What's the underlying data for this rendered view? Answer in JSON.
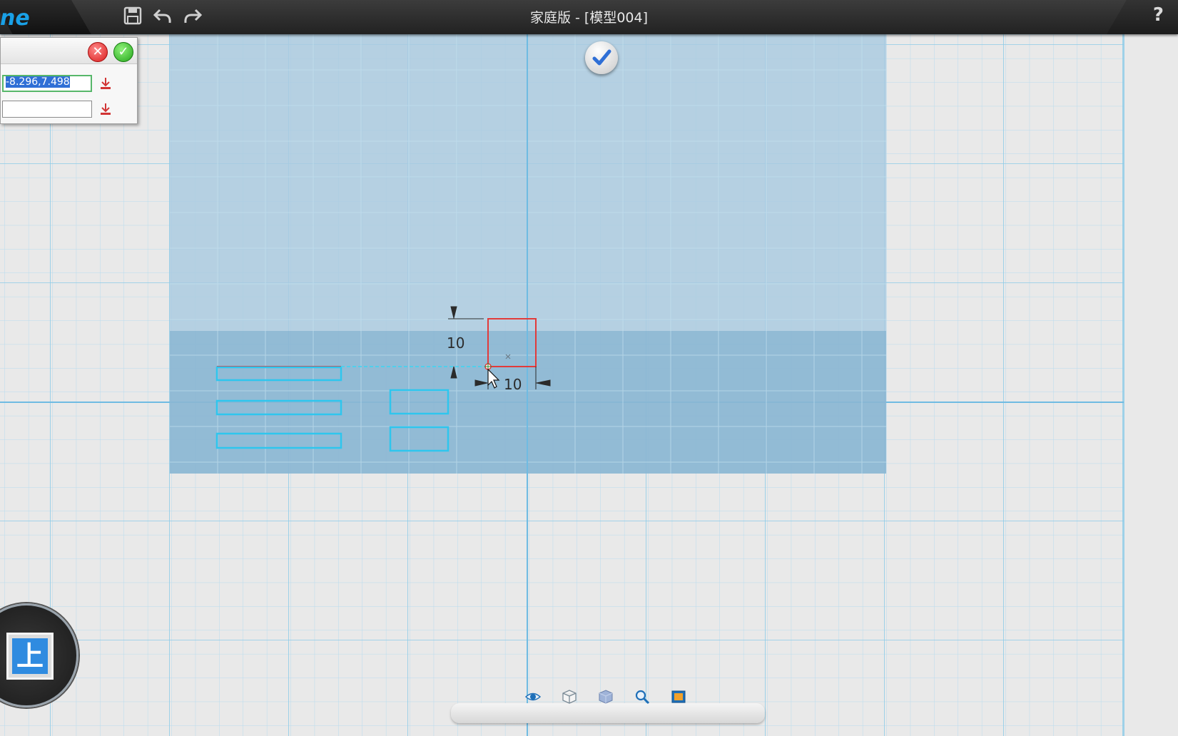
{
  "window": {
    "title": "家庭版 - [模型004]",
    "logo_text": "ne",
    "help_label": "?"
  },
  "toolbar": {
    "icons": [
      "save-icon",
      "undo-icon",
      "redo-icon"
    ]
  },
  "dialog": {
    "cancel_icon": "close-icon",
    "ok_icon": "check-icon",
    "point_value": "-8.296,7.498",
    "second_value": ""
  },
  "sketch": {
    "dimension_vertical": "10",
    "dimension_horizontal": "10"
  },
  "viewcube": {
    "face_label": "上"
  },
  "bottom_toolbar": {
    "icons": [
      "view-eye-icon",
      "wireframe-cube-icon",
      "solid-cube-icon",
      "zoom-icon",
      "render-icon"
    ]
  },
  "colors": {
    "grid_line": "#9fd0ea",
    "workplane_light": "#a9cbe0",
    "workplane_dark": "#8ab6d2",
    "selected_red": "#e23a3a",
    "sketch_cyan": "#2ec6ee",
    "accent_blue": "#2f8be0"
  }
}
